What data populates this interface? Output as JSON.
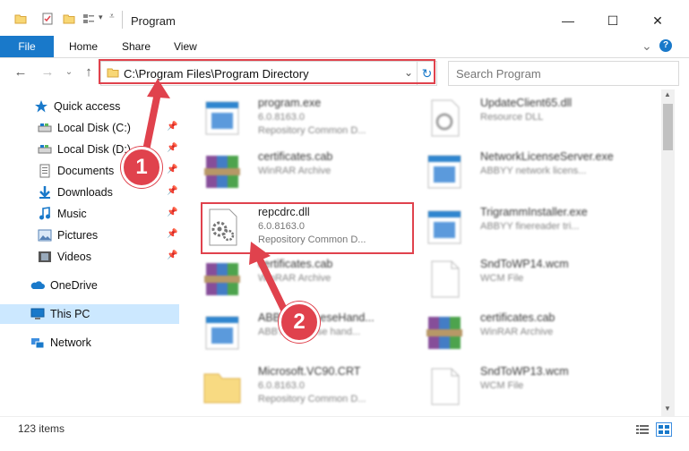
{
  "window": {
    "title": "Program",
    "minimize_glyph": "—",
    "maximize_glyph": "☐",
    "close_glyph": "✕"
  },
  "ribbon": {
    "tabs": [
      "File",
      "Home",
      "Share",
      "View"
    ],
    "expand_glyph": "⌄",
    "help_glyph": "?"
  },
  "address": {
    "path": "C:\\Program Files\\Program Directory",
    "dropdown_glyph": "⌄",
    "refresh_glyph": "↻"
  },
  "search": {
    "placeholder": "Search Program"
  },
  "nav": {
    "back_glyph": "←",
    "forward_glyph": "→",
    "recent_glyph": "⌄",
    "up_glyph": "↑",
    "pin_glyph": "📌",
    "items": [
      {
        "label": "Quick access",
        "icon": "star-icon",
        "pinned": false
      },
      {
        "label": "Local Disk (C:)",
        "icon": "drive-icon",
        "pinned": true
      },
      {
        "label": "Local Disk (D:)",
        "icon": "drive-icon",
        "pinned": true
      },
      {
        "label": "Documents",
        "icon": "documents-icon",
        "pinned": true
      },
      {
        "label": "Downloads",
        "icon": "downloads-icon",
        "pinned": true
      },
      {
        "label": "Music",
        "icon": "music-icon",
        "pinned": true
      },
      {
        "label": "Pictures",
        "icon": "pictures-icon",
        "pinned": true
      },
      {
        "label": "Videos",
        "icon": "videos-icon",
        "pinned": true
      },
      {
        "label": "OneDrive",
        "icon": "onedrive-icon",
        "pinned": false
      },
      {
        "label": "This PC",
        "icon": "pc-icon",
        "pinned": false,
        "selected": true
      },
      {
        "label": "Network",
        "icon": "network-icon",
        "pinned": false
      }
    ]
  },
  "files": [
    {
      "name": "program.exe",
      "line2": "6.0.8163.0",
      "line3": "Repository Common D...",
      "icon": "exe-icon"
    },
    {
      "name": "UpdateClient65.dll",
      "line2": "Resource DLL",
      "line3": "",
      "icon": "dll-icon"
    },
    {
      "name": "certificates.cab",
      "line2": "WinRAR Archive",
      "line3": "",
      "icon": "winrar-icon"
    },
    {
      "name": "NetworkLicenseServer.exe",
      "line2": "ABBYY network licens...",
      "line3": "",
      "icon": "exe-icon"
    },
    {
      "name": "repcdrc.dll",
      "line2": "6.0.8163.0",
      "line3": "Repository Common D...",
      "icon": "dll-gear-icon",
      "highlighted": true
    },
    {
      "name": "TrigrammInstaller.exe",
      "line2": "ABBYY finereader tri...",
      "line3": "",
      "icon": "exe-icon"
    },
    {
      "name": "certificates.cab",
      "line2": "WinRAR Archive",
      "line3": "",
      "icon": "winrar-icon"
    },
    {
      "name": "SndToWP14.wcm",
      "line2": "WCM File",
      "line3": "",
      "icon": "blank-icon"
    },
    {
      "name": "ABBYY.ChineseHand...",
      "line2": "ABBYY chinese hand...",
      "line3": "",
      "icon": "exe-icon"
    },
    {
      "name": "certificates.cab",
      "line2": "WinRAR Archive",
      "line3": "",
      "icon": "winrar-icon"
    },
    {
      "name": "Microsoft.VC90.CRT",
      "line2": "6.0.8163.0",
      "line3": "Repository Common D...",
      "icon": "folder-icon"
    },
    {
      "name": "SndToWP13.wcm",
      "line2": "WCM File",
      "line3": "",
      "icon": "blank-icon"
    }
  ],
  "status": {
    "count": "123 items"
  },
  "callouts": [
    "1",
    "2"
  ],
  "colors": {
    "accent": "#1979ca",
    "highlight": "#e0424d",
    "selected_bg": "#cce8ff"
  }
}
